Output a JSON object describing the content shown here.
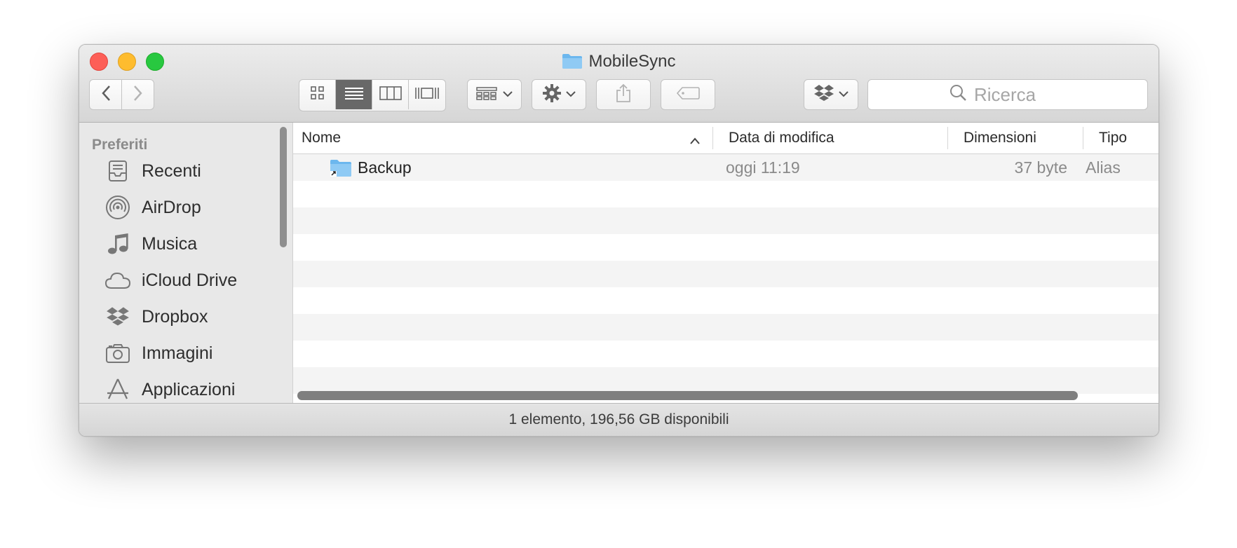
{
  "window": {
    "title": "MobileSync"
  },
  "toolbar": {
    "search_placeholder": "Ricerca",
    "view_mode_selected": "list"
  },
  "sidebar": {
    "section_label": "Preferiti",
    "items": [
      {
        "label": "Recenti",
        "icon": "recents-icon"
      },
      {
        "label": "AirDrop",
        "icon": "airdrop-icon"
      },
      {
        "label": "Musica",
        "icon": "music-icon"
      },
      {
        "label": "iCloud Drive",
        "icon": "icloud-icon"
      },
      {
        "label": "Dropbox",
        "icon": "dropbox-icon"
      },
      {
        "label": "Immagini",
        "icon": "camera-icon"
      },
      {
        "label": "Applicazioni",
        "icon": "applications-icon"
      }
    ]
  },
  "table": {
    "columns": {
      "name": "Nome",
      "modified": "Data di modifica",
      "size": "Dimensioni",
      "kind": "Tipo"
    },
    "rows": [
      {
        "name": "Backup",
        "modified": "oggi 11:19",
        "size": "37 byte",
        "kind": "Alias"
      }
    ]
  },
  "status": {
    "text": "1 elemento, 196,56 GB disponibili"
  },
  "colors": {
    "folder": "#6cb7ee",
    "selected_view": "#686868",
    "accent_red": "#fd5f57",
    "accent_yellow": "#febc2e",
    "accent_green": "#28c840"
  }
}
